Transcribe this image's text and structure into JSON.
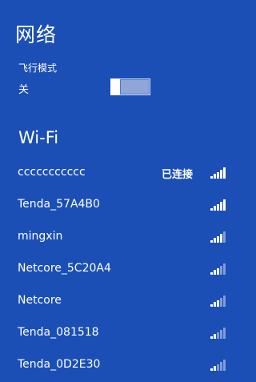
{
  "title": "网络",
  "airplane_mode": {
    "label": "飞行模式",
    "state": "关",
    "on": false
  },
  "wifi_header": "Wi-Fi",
  "networks": [
    {
      "name": "ccccccccccc",
      "status": "已连接",
      "signal": 5
    },
    {
      "name": "Tenda_57A4B0",
      "status": "",
      "signal": 5
    },
    {
      "name": "mingxin",
      "status": "",
      "signal": 4
    },
    {
      "name": "Netcore_5C20A4",
      "status": "",
      "signal": 3
    },
    {
      "name": "Netcore",
      "status": "",
      "signal": 3
    },
    {
      "name": "Tenda_081518",
      "status": "",
      "signal": 2
    },
    {
      "name": "Tenda_0D2E30",
      "status": "",
      "signal": 2
    }
  ],
  "colors": {
    "background": "#1b4fb5",
    "text": "#ffffff",
    "signal_dim": "#7f9dd6"
  },
  "icons": {
    "signal": "wifi-signal-bars-icon"
  }
}
